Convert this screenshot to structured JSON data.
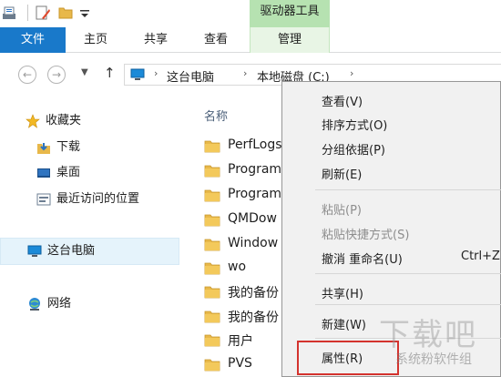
{
  "titlebar": {
    "contextual_tab_group": "驱动器工具"
  },
  "ribbon": {
    "tabs": [
      "文件",
      "主页",
      "共享",
      "查看",
      "管理"
    ]
  },
  "address": {
    "breadcrumbs": [
      "这台电脑",
      "本地磁盘 (C:)"
    ],
    "separator": "›"
  },
  "nav": {
    "items": [
      "收藏夹",
      "下载",
      "桌面",
      "最近访问的位置",
      "这台电脑",
      "网络"
    ],
    "selected": "这台电脑"
  },
  "list": {
    "column_header": "名称",
    "files": [
      "PerfLogs",
      "Program",
      "Program",
      "QMDow",
      "Window",
      "wo",
      "我的备份",
      "我的备份",
      "用户",
      "PVS"
    ]
  },
  "context_menu": {
    "items": [
      {
        "label": "查看(V)",
        "shortcut": "",
        "enabled": true
      },
      {
        "label": "排序方式(O)",
        "shortcut": "",
        "enabled": true
      },
      {
        "label": "分组依据(P)",
        "shortcut": "",
        "enabled": true
      },
      {
        "label": "刷新(E)",
        "shortcut": "",
        "enabled": true
      },
      {
        "label": "粘贴(P)",
        "shortcut": "",
        "enabled": false
      },
      {
        "label": "粘贴快捷方式(S)",
        "shortcut": "",
        "enabled": false
      },
      {
        "label": "撤消 重命名(U)",
        "shortcut": "Ctrl+Z",
        "enabled": true
      },
      {
        "label": "共享(H)",
        "shortcut": "",
        "enabled": true
      },
      {
        "label": "新建(W)",
        "shortcut": "",
        "enabled": true
      },
      {
        "label": "属性(R)",
        "shortcut": "",
        "enabled": true
      }
    ],
    "highlighted": "属性(R)"
  },
  "watermark": {
    "big": "下载吧",
    "small": "系统粉软件组"
  },
  "colors": {
    "file_tab": "#1979ca",
    "drive_tools": "#b6e2b1",
    "nav_selected": "#e5f3fb",
    "menu_bg": "#f1f1f1",
    "highlight_box": "#d4332e",
    "folder": "#e8b84a"
  },
  "icons": [
    "properties-icon",
    "new-folder-icon",
    "folder-icon",
    "dropdown-icon",
    "back-icon",
    "forward-icon",
    "recent-locations-icon",
    "up-arrow-icon",
    "computer-icon",
    "star-icon",
    "downloads-icon",
    "desktop-icon",
    "recent-places-icon",
    "network-icon"
  ]
}
